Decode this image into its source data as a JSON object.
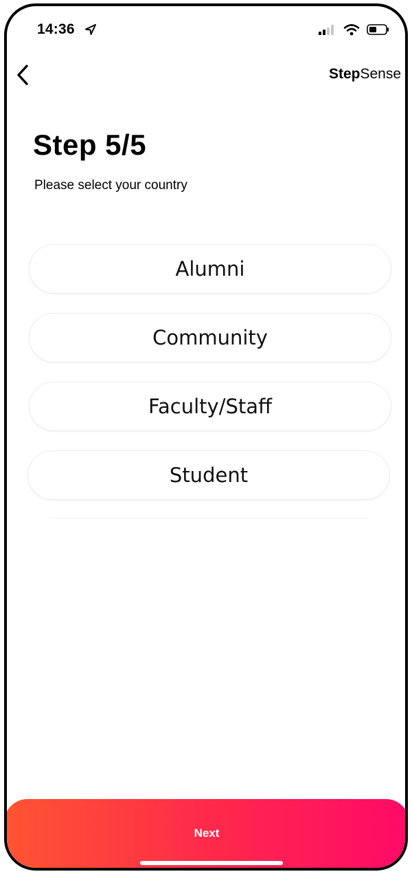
{
  "status_bar": {
    "time": "14:36",
    "icons": [
      "location-arrow-icon",
      "cellular-signal-icon",
      "wifi-icon",
      "battery-icon"
    ]
  },
  "nav": {
    "back_icon": "chevron-left-icon",
    "brand_bold": "Step",
    "brand_regular": "Sense"
  },
  "header": {
    "title": "Step 5/5",
    "subtitle": "Please select your country"
  },
  "options": [
    {
      "label": "Alumni"
    },
    {
      "label": "Community"
    },
    {
      "label": "Faculty/Staff"
    },
    {
      "label": "Student"
    }
  ],
  "footer": {
    "next_label": "Next"
  },
  "colors": {
    "gradient_start": "#ff5533",
    "gradient_end": "#ff0a68",
    "text": "#000000",
    "option_border": "#ececec"
  }
}
